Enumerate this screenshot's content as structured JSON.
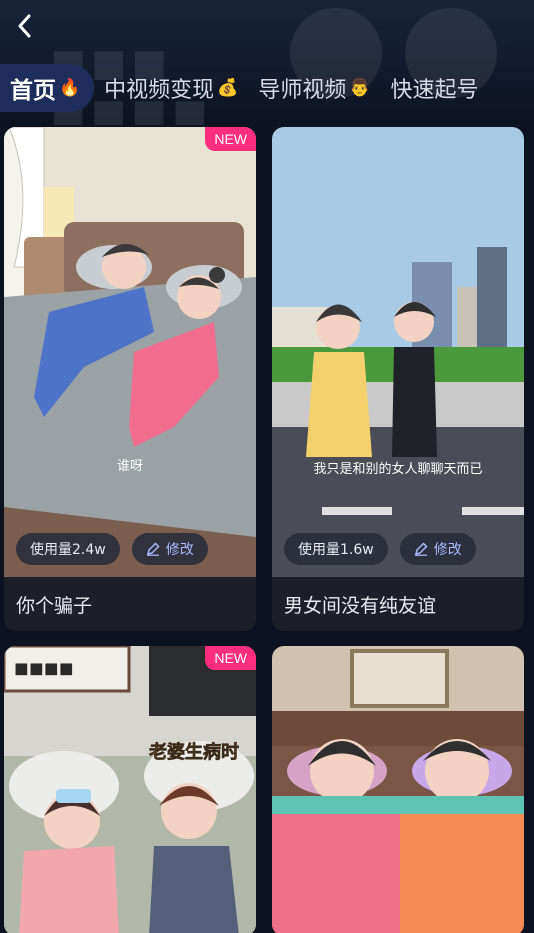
{
  "nav": {
    "back_icon": "chevron-left-icon"
  },
  "tabs": [
    {
      "label": "首页",
      "emoji": "🔥",
      "active": true
    },
    {
      "label": "中视频变现",
      "emoji": "💰",
      "active": false
    },
    {
      "label": "导师视频",
      "emoji": "👨",
      "active": false
    },
    {
      "label": "快速起号",
      "emoji": "",
      "active": false
    }
  ],
  "cards": [
    {
      "title": "你个骗子",
      "new_badge": "NEW",
      "usage": "使用量2.4w",
      "edit": "修改",
      "overlay_text": "谁呀"
    },
    {
      "title": "男女间没有纯友谊",
      "new_badge": "",
      "usage": "使用量1.6w",
      "edit": "修改",
      "overlay_text": "我只是和别的女人聊聊天而已"
    },
    {
      "title": "",
      "new_badge": "NEW",
      "usage": "",
      "edit": "",
      "overlay_text": "老婆生病时"
    },
    {
      "title": "",
      "new_badge": "",
      "usage": "",
      "edit": "",
      "overlay_text": ""
    }
  ],
  "colors": {
    "accent": "#1e2d5c",
    "badge": "#ff2d7e",
    "edit": "#a9b7ff"
  }
}
